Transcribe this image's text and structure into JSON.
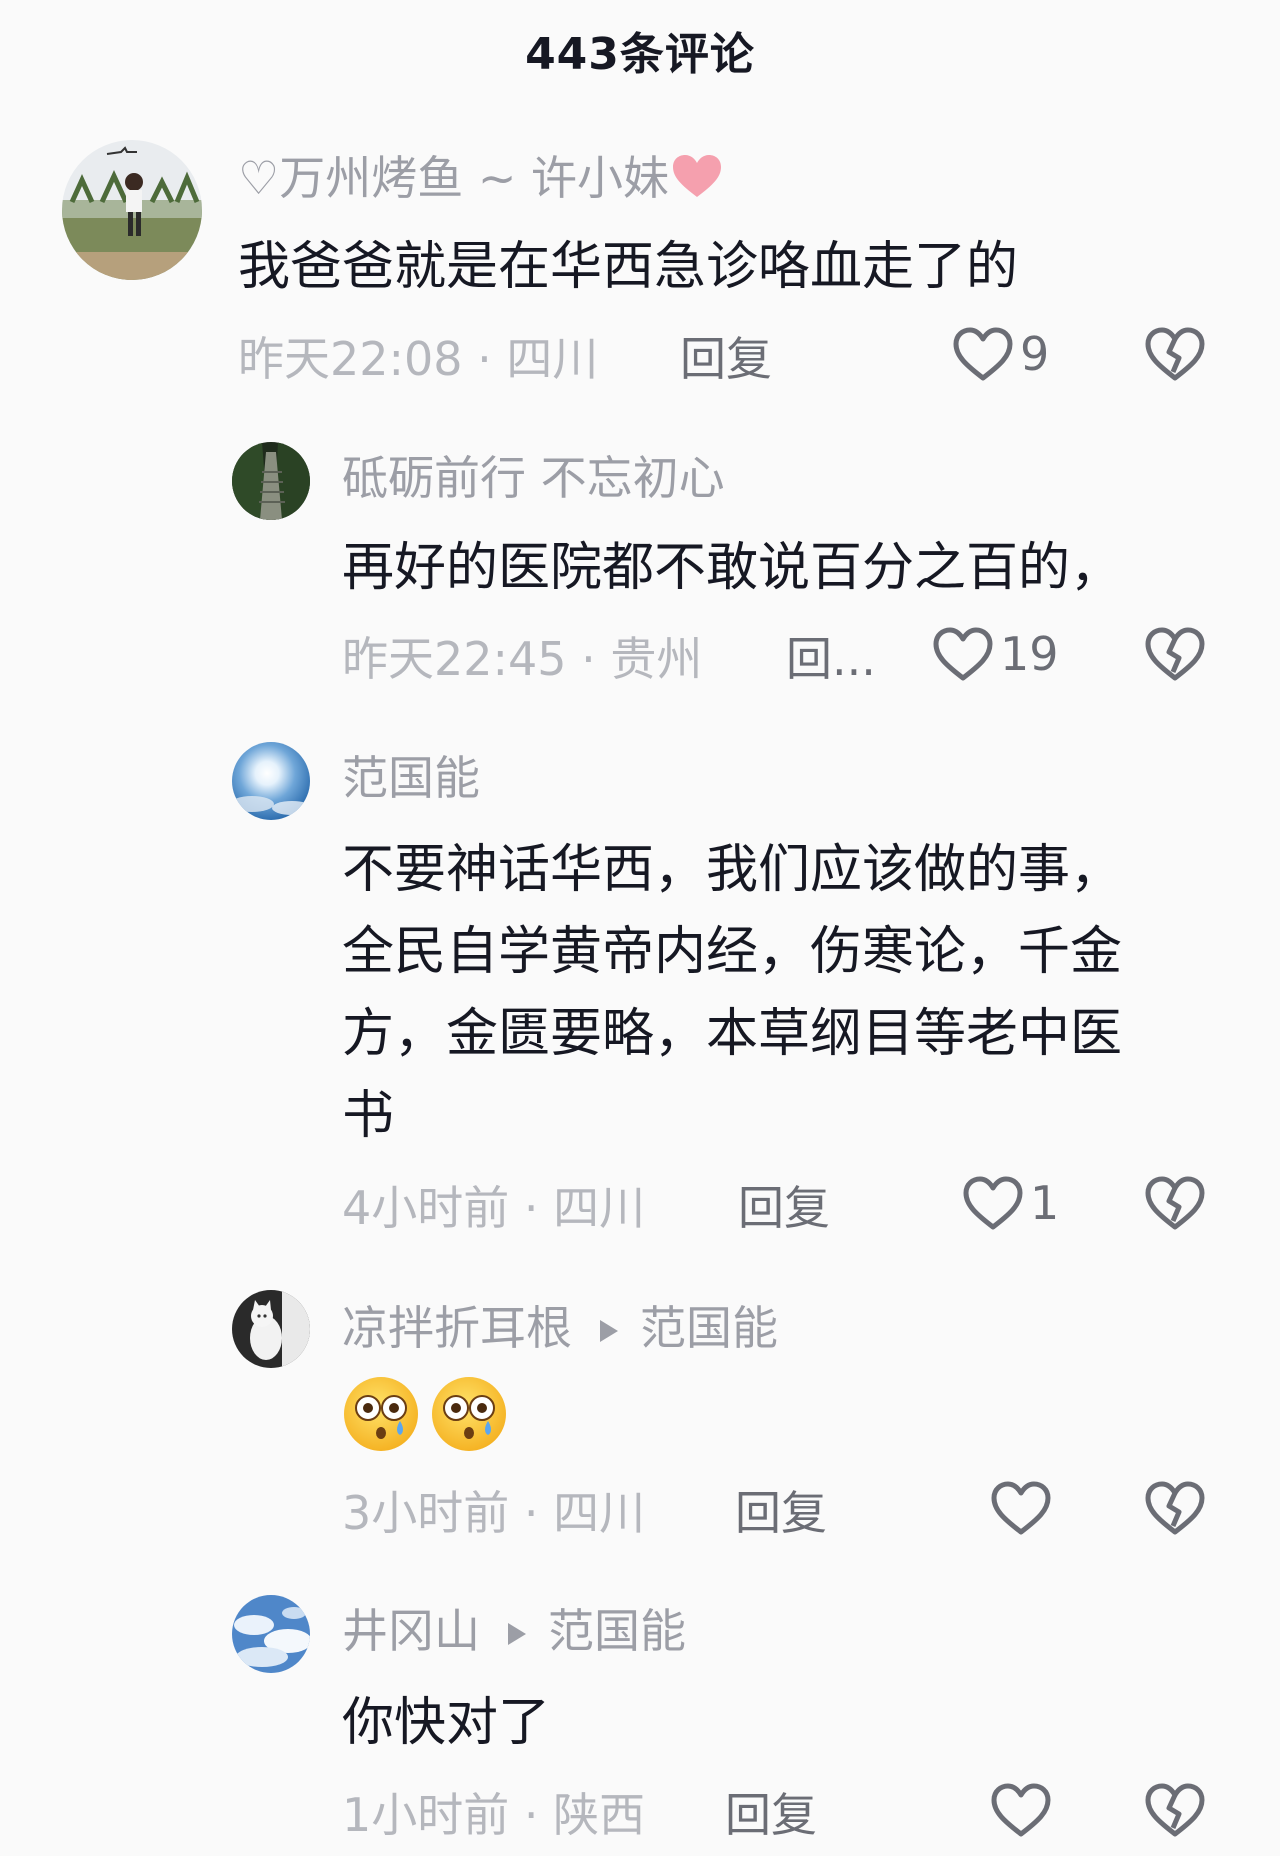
{
  "header": {
    "title": "443条评论"
  },
  "comments": [
    {
      "username": "♡万州烤鱼 ~ 许小妹",
      "text_lines": [
        "我爸爸就是在华西急诊咯血走了的"
      ],
      "time_location": "昨天22:08 · 四川",
      "reply_label": "回复",
      "likes": "9"
    },
    {
      "username": "砥砺前行 不忘初心",
      "text_lines": [
        "再好的医院都不敢说百分之百的，"
      ],
      "time_location": "昨天22:45 · 贵州",
      "reply_label": "回...",
      "likes": "19"
    },
    {
      "username": "范国能",
      "text_lines": [
        "不要神话华西，我们应该做的事，",
        "全民自学黄帝内经，伤寒论，千金",
        "方，金匮要略，本草纲目等老中医",
        "书"
      ],
      "time_location": "4小时前 · 四川",
      "reply_label": "回复",
      "likes": "1"
    },
    {
      "username": "凉拌折耳根",
      "reply_to": "范国能",
      "emoji": [
        "flushed-face-icon",
        "flushed-face-icon"
      ],
      "time_location": "3小时前 · 四川",
      "reply_label": "回复",
      "likes": ""
    },
    {
      "username": "井冈山",
      "reply_to": "范国能",
      "text_lines": [
        "你快对了"
      ],
      "time_location": "1小时前 · 陕西",
      "reply_label": "回复",
      "likes": ""
    }
  ],
  "colors": {
    "username": "#9c9ea6",
    "text": "#161823",
    "meta": "#b5b7bd",
    "badge_heart": "#f5a0ae"
  }
}
